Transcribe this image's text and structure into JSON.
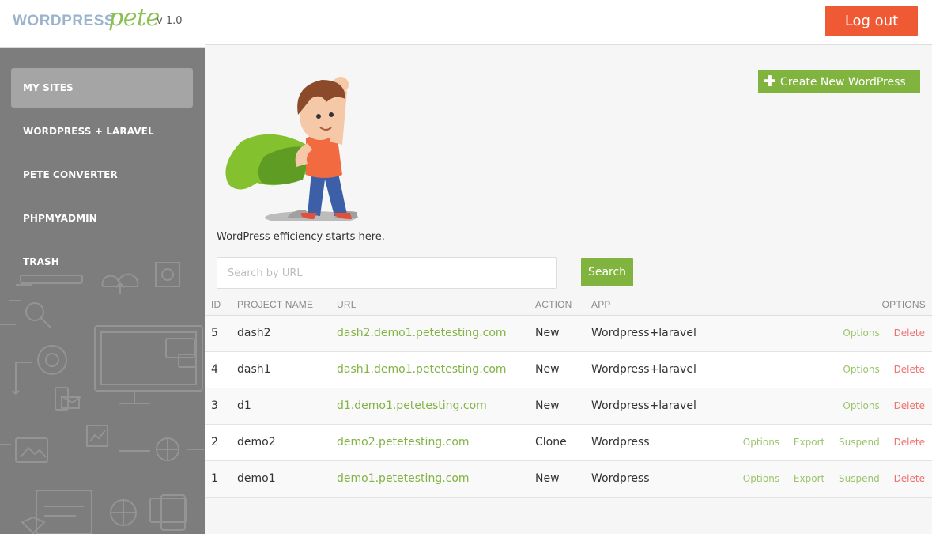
{
  "brand": {
    "logo_word": "WORDPRESS",
    "logo_script": "pete",
    "version": "v 1.0"
  },
  "sidebar": {
    "items": [
      {
        "label": "MY SITES",
        "active": true
      },
      {
        "label": "WORDPRESS + LARAVEL",
        "active": false
      },
      {
        "label": "PETE CONVERTER",
        "active": false
      },
      {
        "label": "PHPMYADMIN",
        "active": false
      },
      {
        "label": "TRASH",
        "active": false
      }
    ]
  },
  "header": {
    "logout_label": "Log out"
  },
  "main": {
    "create_label": "Create New WordPress",
    "tagline": "WordPress efficiency starts here.",
    "search_placeholder": "Search by URL",
    "search_button": "Search"
  },
  "table": {
    "columns": [
      "ID",
      "PROJECT NAME",
      "URL",
      "ACTION",
      "APP",
      "OPTIONS"
    ],
    "rows": [
      {
        "id": "5",
        "name": "dash2",
        "url": "dash2.demo1.petetesting.com",
        "action": "New",
        "app": "Wordpress+laravel",
        "actions": [
          "Options",
          "Delete"
        ]
      },
      {
        "id": "4",
        "name": "dash1",
        "url": "dash1.demo1.petetesting.com",
        "action": "New",
        "app": "Wordpress+laravel",
        "actions": [
          "Options",
          "Delete"
        ]
      },
      {
        "id": "3",
        "name": "d1",
        "url": "d1.demo1.petetesting.com",
        "action": "New",
        "app": "Wordpress+laravel",
        "actions": [
          "Options",
          "Delete"
        ]
      },
      {
        "id": "2",
        "name": "demo2",
        "url": "demo2.petetesting.com",
        "action": "Clone",
        "app": "Wordpress",
        "actions": [
          "Options",
          "Export",
          "Suspend",
          "Delete"
        ]
      },
      {
        "id": "1",
        "name": "demo1",
        "url": "demo1.petetesting.com",
        "action": "New",
        "app": "Wordpress",
        "actions": [
          "Options",
          "Export",
          "Suspend",
          "Delete"
        ]
      }
    ]
  },
  "colors": {
    "accent_green": "#80b43f",
    "logout_orange": "#ef5a34",
    "delete_red": "#f06f6f",
    "sidebar_gray": "#7d7d7d"
  },
  "icons": [
    "plus-icon",
    "hero-illustration",
    "sidebar-decoration"
  ]
}
